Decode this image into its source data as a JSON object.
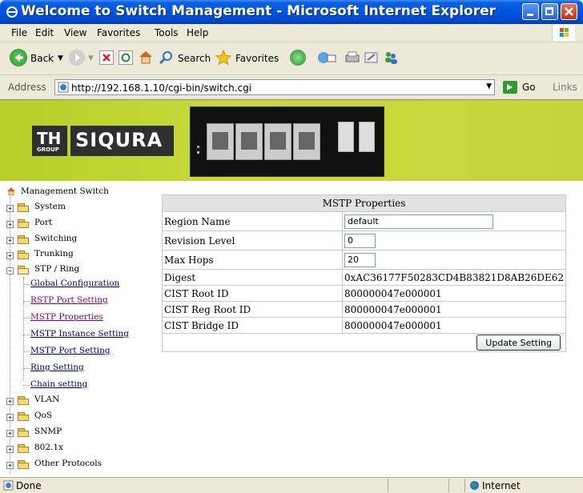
{
  "window": {
    "title": "Welcome to Switch Management - Microsoft Internet Explorer"
  },
  "menu": [
    "File",
    "Edit",
    "View",
    "Favorites",
    "Tools",
    "Help"
  ],
  "toolbar": {
    "back_label": "Back",
    "search_label": "Search",
    "favorites_label": "Favorites"
  },
  "address": {
    "label": "Address",
    "url": "http://192.168.1.10/cgi-bin/switch.cgi",
    "go_label": "Go",
    "links_label": "Links"
  },
  "brand": {
    "group_mark": "TH GROUP",
    "name": "SIQURA"
  },
  "tree": {
    "root": "Management Switch",
    "items": [
      {
        "label": "System"
      },
      {
        "label": "Port"
      },
      {
        "label": "Switching"
      },
      {
        "label": "Trunking"
      },
      {
        "label": "STP / Ring"
      }
    ],
    "stp_children": [
      {
        "label": "Global Configuration"
      },
      {
        "label": "RSTP Port Setting"
      },
      {
        "label": "MSTP Properties"
      },
      {
        "label": "MSTP Instance Setting"
      },
      {
        "label": "MSTP Port Setting"
      },
      {
        "label": "Ring Setting"
      },
      {
        "label": "Chain setting"
      }
    ],
    "items_after": [
      {
        "label": "VLAN"
      },
      {
        "label": "QoS"
      },
      {
        "label": "SNMP"
      },
      {
        "label": "802.1x"
      },
      {
        "label": "Other Protocols"
      }
    ]
  },
  "mstp": {
    "header": "MSTP Properties",
    "region_name_label": "Region Name",
    "region_name_value": "default",
    "revision_level_label": "Revision Level",
    "revision_level_value": "0",
    "max_hops_label": "Max Hops",
    "max_hops_value": "20",
    "digest_label": "Digest",
    "digest_value": "0xAC36177F50283CD4B83821D8AB26DE62",
    "cist_root_label": "CIST Root ID",
    "cist_root_value": "800000047e000001",
    "cist_reg_root_label": "CIST Reg Root ID",
    "cist_reg_root_value": "800000047e000001",
    "cist_bridge_label": "CIST Bridge ID",
    "cist_bridge_value": "800000047e000001",
    "update_button": "Update Setting"
  },
  "status": {
    "left": "Done",
    "zone": "Internet"
  }
}
